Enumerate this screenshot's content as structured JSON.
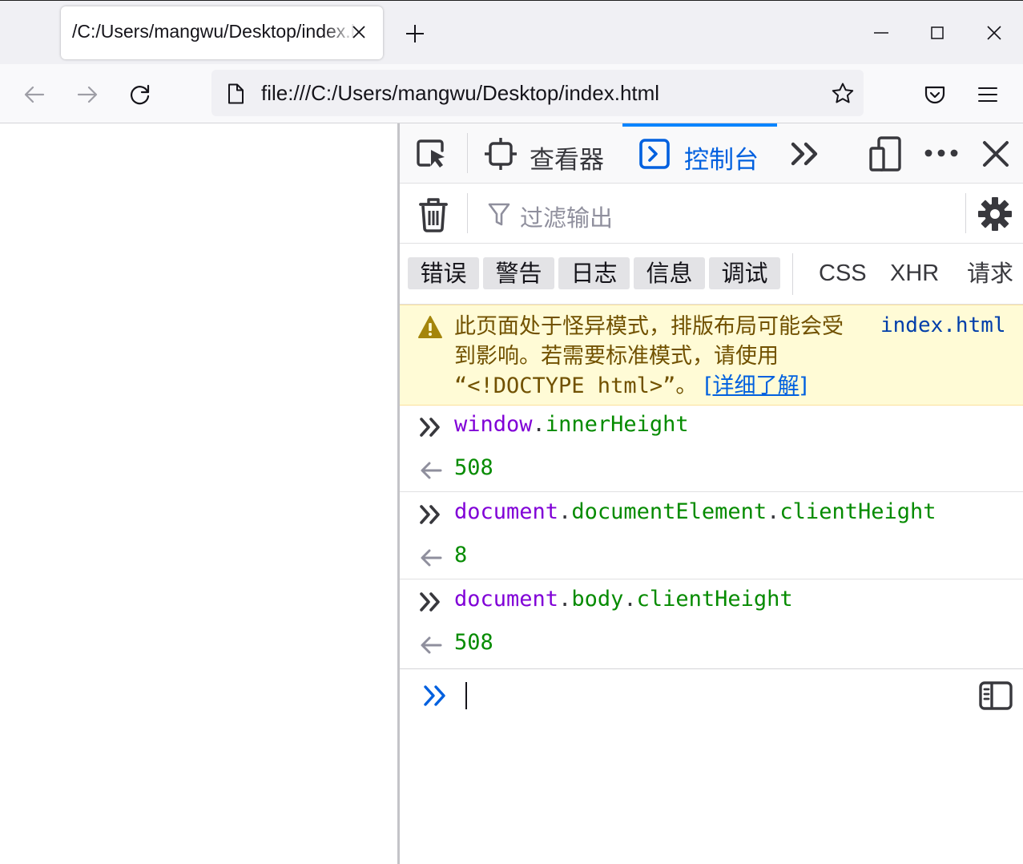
{
  "browser": {
    "tab": {
      "title": "/C:/Users/mangwu/Desktop/index.html",
      "close_icon": "close-icon"
    },
    "new_tab_icon": "plus-icon",
    "window_controls": [
      "minimize-icon",
      "maximize-icon",
      "close-icon"
    ],
    "nav": {
      "back_icon": "arrow-left-icon",
      "forward_icon": "arrow-right-icon",
      "reload_icon": "reload-icon",
      "url": "file:///C:/Users/mangwu/Desktop/index.html",
      "page_icon": "document-icon",
      "bookmark_icon": "star-icon",
      "pocket_icon": "pocket-icon",
      "menu_icon": "hamburger-icon"
    }
  },
  "devtools": {
    "toolbar": {
      "picker_icon": "element-picker-icon",
      "tabs": [
        {
          "label": "查看器",
          "icon": "inspector-icon",
          "selected": false
        },
        {
          "label": "控制台",
          "icon": "console-icon",
          "selected": true
        }
      ],
      "more_tools_icon": "double-chevron-icon",
      "responsive_icon": "responsive-design-icon",
      "options_icon": "ellipsis-icon",
      "close_icon": "close-icon"
    },
    "filter": {
      "clear_icon": "trash-icon",
      "placeholder": "过滤输出",
      "settings_icon": "gear-icon"
    },
    "categories": {
      "toggles": [
        "错误",
        "警告",
        "日志",
        "信息",
        "调试"
      ],
      "network": [
        "CSS",
        "XHR",
        "请求"
      ]
    },
    "warning": {
      "icon": "warning-icon",
      "message": "此页面处于怪异模式，排版布局可能会受到影响。若需要标准模式，请使用",
      "doctype": "“<!DOCTYPE html>”。",
      "learn_more": "[详细了解]",
      "source": "index.html"
    },
    "entries": [
      {
        "input": [
          "window",
          ".",
          "innerHeight"
        ],
        "output": "508"
      },
      {
        "input": [
          "document",
          ".",
          "documentElement",
          ".",
          "clientHeight"
        ],
        "output": "8"
      },
      {
        "input": [
          "document",
          ".",
          "body",
          ".",
          "clientHeight"
        ],
        "output": "508"
      }
    ],
    "prompt": {
      "icon": "prompt-chevron-icon",
      "value": "",
      "sidebar_icon": "sidebar-toggle-icon"
    }
  },
  "colors": {
    "accent": "#0a84ff",
    "console_object": "#8000d7",
    "console_property": "#058b00",
    "warning_bg": "#fffbd6",
    "warning_text": "#715100",
    "link": "#0060df"
  }
}
